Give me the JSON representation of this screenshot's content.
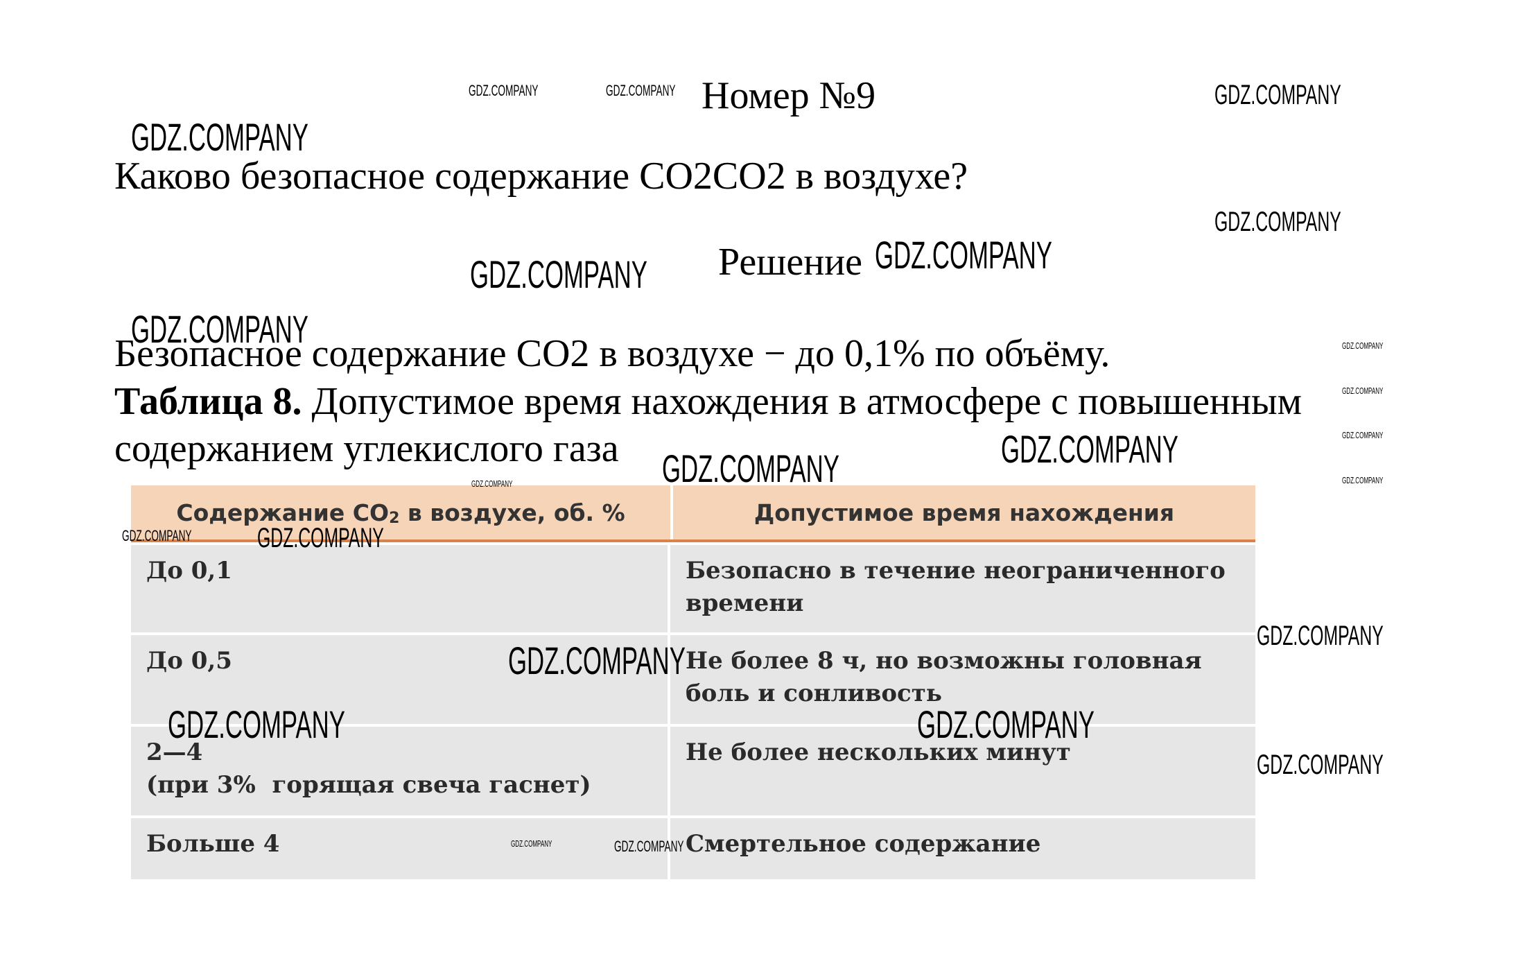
{
  "title": "Номер №9",
  "question": "Каково безопасное содержание CO2CO2 в воздухе?",
  "solution_label": "Решение",
  "answer": "Безопасное содержание CO2 в воздухе − до 0,1% по объёму.",
  "table_caption": {
    "label": "Таблица 8.",
    "text": " Допустимое время нахождения в атмосфере с повышенным содержанием углекислого газа"
  },
  "table": {
    "headers": {
      "col1_prefix": "Содержание CO",
      "col1_sub": "2",
      "col1_suffix": " в воздухе, об. %",
      "col2": "Допустимое время нахождения"
    },
    "rows": [
      {
        "content_line1": "До 0,1",
        "content_line2": "",
        "time_line1": "Безопасно в течение неограниченного",
        "time_line2": "времени"
      },
      {
        "content_line1": "До 0,5",
        "content_line2": "",
        "time_line1": "Не более 8 ч, но возможны головная",
        "time_line2": "боль и сонливость"
      },
      {
        "content_line1": "2—4",
        "content_line2": "(при 3%  горящая свеча гаснет)",
        "time_line1": "Не более нескольких минут",
        "time_line2": ""
      },
      {
        "content_line1": "Больше 4",
        "content_line2": "",
        "time_line1": "Смертельное содержание",
        "time_line2": ""
      }
    ]
  },
  "watermark": "GDZ.COMPANY"
}
